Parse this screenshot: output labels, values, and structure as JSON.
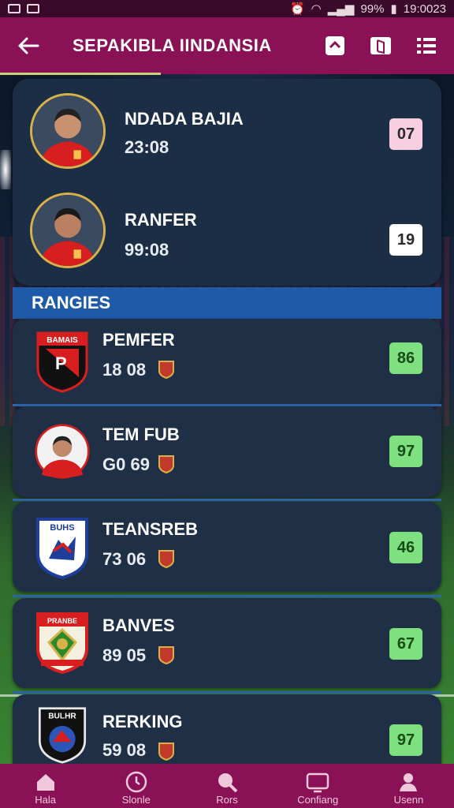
{
  "status_bar": {
    "battery_percent": "99%",
    "time": "19:0023"
  },
  "app_bar": {
    "title": "SEPAKIBLA IINDANSIA"
  },
  "top_card": {
    "players": [
      {
        "name": "NDADA BAJIA",
        "time": "23:08",
        "score": "07",
        "score_color": "#f6cfe0"
      },
      {
        "name": "RANFER",
        "time": "99:08",
        "score": "19",
        "score_color": "#ffffff"
      }
    ]
  },
  "section": {
    "title": "RANGIES"
  },
  "list": [
    {
      "name": "PEMFER",
      "score": "18 08",
      "rating": "86",
      "crest": "crest-bamais",
      "crest_text": "BAMAIS"
    },
    {
      "name": "TEM FUB",
      "score": "G0 69",
      "rating": "97",
      "crest": "player-photo"
    },
    {
      "name": "TEANSREB",
      "score": "73 06",
      "rating": "46",
      "crest": "crest-buhs",
      "crest_text": "BUHS"
    },
    {
      "name": "BANVES",
      "score": "89 05",
      "rating": "67",
      "crest": "crest-pranbe",
      "crest_text": "PRANBE"
    },
    {
      "name": "RERKING",
      "score": "59 08",
      "rating": "97",
      "crest": "crest-bulhr",
      "crest_text": "BULHR"
    }
  ],
  "bottom_nav": [
    {
      "label": "Hala",
      "icon": "home-icon"
    },
    {
      "label": "Slonle",
      "icon": "clock-icon"
    },
    {
      "label": "Rors",
      "icon": "search-icon"
    },
    {
      "label": "Confiang",
      "icon": "tv-icon"
    },
    {
      "label": "Usenn",
      "icon": "user-icon"
    }
  ],
  "colors": {
    "app_bar": "#8a1156",
    "section_header": "#1e5aa8",
    "rating_green": "#7fe07f"
  }
}
